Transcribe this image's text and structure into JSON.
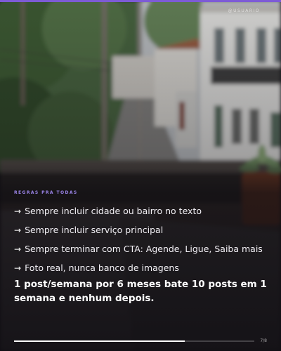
{
  "slide": {
    "handle": "@USUARIO",
    "kicker": "REGRAS PRA TODAS",
    "bullets": [
      {
        "icon": "arrow-right-icon",
        "text": "Sempre incluir cidade ou bairro no texto"
      },
      {
        "icon": "arrow-right-icon",
        "text": "Sempre incluir serviço principal"
      },
      {
        "icon": "arrow-right-icon",
        "text": "Sempre terminar com CTA: Agende, Ligue, Saiba mais"
      },
      {
        "icon": "arrow-right-icon",
        "text": "Foto real, nunca banco de imagens"
      }
    ],
    "closing": "1 post/semana por 6 meses bate 10 posts em 1 semana e nenhum depois.",
    "page_number": "7/8",
    "progress": 0.71
  },
  "colors": {
    "accent": "#7d5bd6",
    "kicker": "#9a83e6",
    "text": "#f2f0f5",
    "background": "#0f0d12"
  }
}
